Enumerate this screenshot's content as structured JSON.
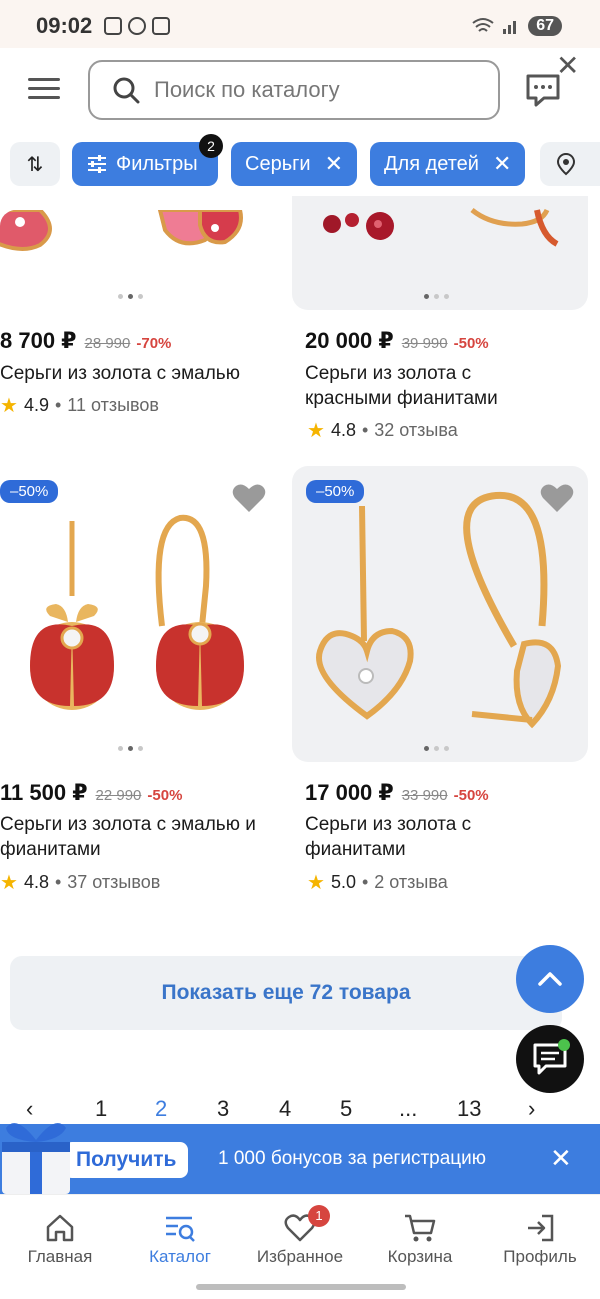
{
  "status_bar": {
    "time": "09:02",
    "battery": "67"
  },
  "search": {
    "placeholder": "Поиск по каталогу"
  },
  "filters": {
    "filter_label": "Фильтры",
    "filter_count": "2",
    "chips": [
      "Серьги",
      "Для детей"
    ]
  },
  "products": [
    {
      "price": "8 700 ₽",
      "old_price": "28 990",
      "discount": "-70%",
      "title": "Серьги из золота с эмалью",
      "rating": "4.9",
      "reviews": "11 отзывов"
    },
    {
      "price": "20 000 ₽",
      "old_price": "39 990",
      "discount": "-50%",
      "title": "Серьги из золота с красными фианитами",
      "rating": "4.8",
      "reviews": "32 отзыва"
    },
    {
      "badge": "–50%",
      "price": "11 500 ₽",
      "old_price": "22 990",
      "discount": "-50%",
      "title": "Серьги из золота с эмалью и фианитами",
      "rating": "4.8",
      "reviews": "37 отзывов"
    },
    {
      "badge": "–50%",
      "price": "17 000 ₽",
      "old_price": "33 990",
      "discount": "-50%",
      "title": "Серьги из золота с фианитами",
      "rating": "5.0",
      "reviews": "2 отзыва"
    }
  ],
  "show_more": "Показать еще 72 товара",
  "pagination": {
    "pages": [
      "1",
      "2",
      "3",
      "4",
      "5",
      "...",
      "13"
    ],
    "current": "2"
  },
  "promo": {
    "button": "Получить",
    "text": "1 000 бонусов за регистрацию"
  },
  "bottom_nav": {
    "items": [
      "Главная",
      "Каталог",
      "Избранное",
      "Корзина",
      "Профиль"
    ],
    "active": "Каталог",
    "favorites_badge": "1"
  },
  "colors": {
    "accent": "#3d7ddf",
    "discount": "#d6453f",
    "star": "#f5b400",
    "enamel": "#c8322d",
    "gold": "#e3a74f"
  }
}
